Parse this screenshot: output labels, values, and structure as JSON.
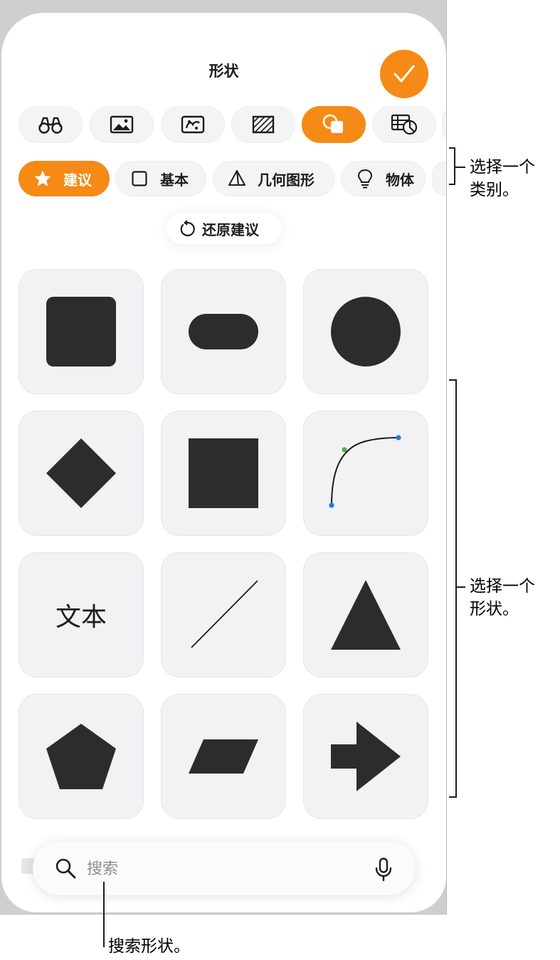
{
  "panel": {
    "title": "形状",
    "done_icon": "checkmark-icon"
  },
  "tool_tabs": [
    {
      "icon": "binoculars-icon",
      "active": false
    },
    {
      "icon": "photo-icon",
      "active": false
    },
    {
      "icon": "photo-sticker-icon",
      "active": false
    },
    {
      "icon": "texture-pattern-icon",
      "active": false
    },
    {
      "icon": "shapes-icon",
      "active": true
    },
    {
      "icon": "table-chart-icon",
      "active": false
    }
  ],
  "categories": [
    {
      "label": "建议",
      "icon": "star-icon",
      "active": true
    },
    {
      "label": "基本",
      "icon": "square-outline-icon",
      "active": false
    },
    {
      "label": "几何图形",
      "icon": "pyramid-icon",
      "active": false
    },
    {
      "label": "物体",
      "icon": "lightbulb-icon",
      "active": false
    }
  ],
  "restore": {
    "label": "还原建议",
    "icon": "undo-arrow-icon"
  },
  "shapes": [
    {
      "name": "rounded-square"
    },
    {
      "name": "pill"
    },
    {
      "name": "circle"
    },
    {
      "name": "diamond"
    },
    {
      "name": "square"
    },
    {
      "name": "curve"
    },
    {
      "name": "text",
      "label": "文本"
    },
    {
      "name": "line"
    },
    {
      "name": "triangle"
    },
    {
      "name": "pentagon"
    },
    {
      "name": "parallelogram"
    },
    {
      "name": "arrow"
    }
  ],
  "search": {
    "placeholder": "搜索",
    "value": "",
    "icon": "search-icon",
    "mic_icon": "microphone-icon"
  },
  "callouts": {
    "category": "选择一个\n类别。",
    "shape": "选择一个\n形状。",
    "search": "搜索形状。"
  },
  "colors": {
    "accent": "#f58a16",
    "shape_fill": "#2c2c2e",
    "curve_green": "#4caf50",
    "curve_blue": "#1e7ae6"
  }
}
